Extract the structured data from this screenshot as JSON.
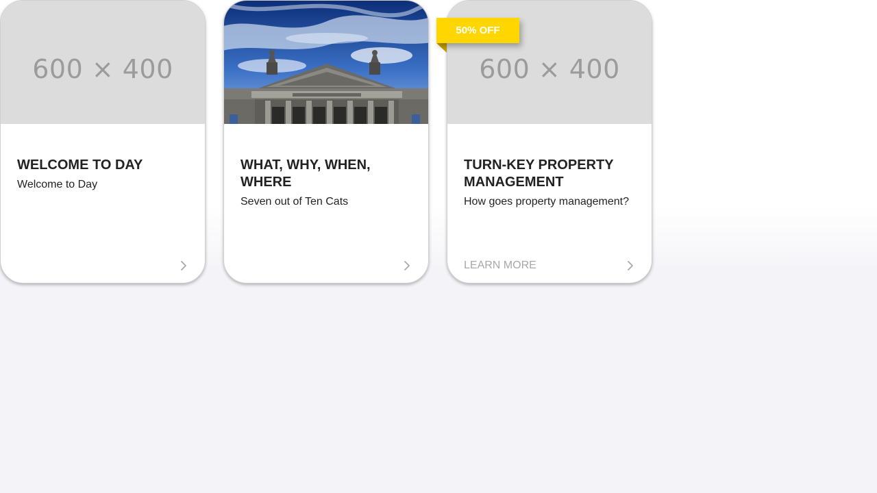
{
  "cards": [
    {
      "image_text": "600 × 400",
      "title": "WELCOME TO DAY",
      "subtitle": "Welcome to Day",
      "link_label": ""
    },
    {
      "image_text": "",
      "title": "WHAT, WHY, WHEN, WHERE",
      "subtitle": "Seven out of Ten Cats",
      "link_label": ""
    },
    {
      "image_text": "600 × 400",
      "title": "TURN-KEY PROPERTY MANAGEMENT",
      "subtitle": "How goes property management?",
      "link_label": "LEARN MORE",
      "badge": "50% OFF"
    }
  ],
  "colors": {
    "badge": "#ffd600",
    "badge_fold": "#c5a400",
    "placeholder_bg": "#dcdcdc",
    "placeholder_text": "#9b9b9b",
    "link": "#a8a8a8"
  }
}
